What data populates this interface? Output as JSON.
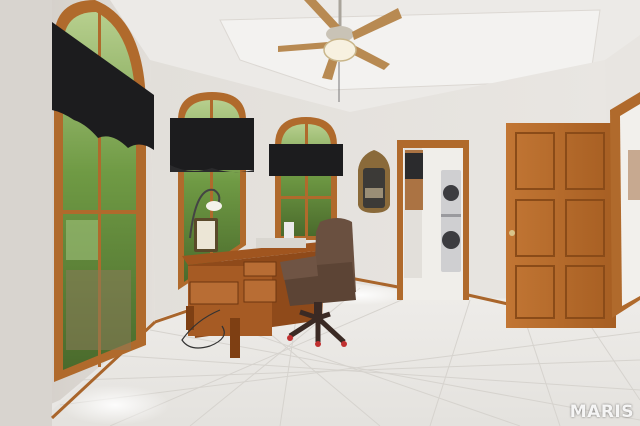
{
  "photo": {
    "watermark": "MARIS"
  },
  "colors": {
    "wall": "#e6e3df",
    "ceiling": "#efedea",
    "floor_tile": "#eceae6",
    "wood_trim": "#b06a2c",
    "door_wood": "#b8692a",
    "valance": "#1c1c1e",
    "chair_leather": "#6a5040",
    "foliage": "#5e8a3a"
  }
}
